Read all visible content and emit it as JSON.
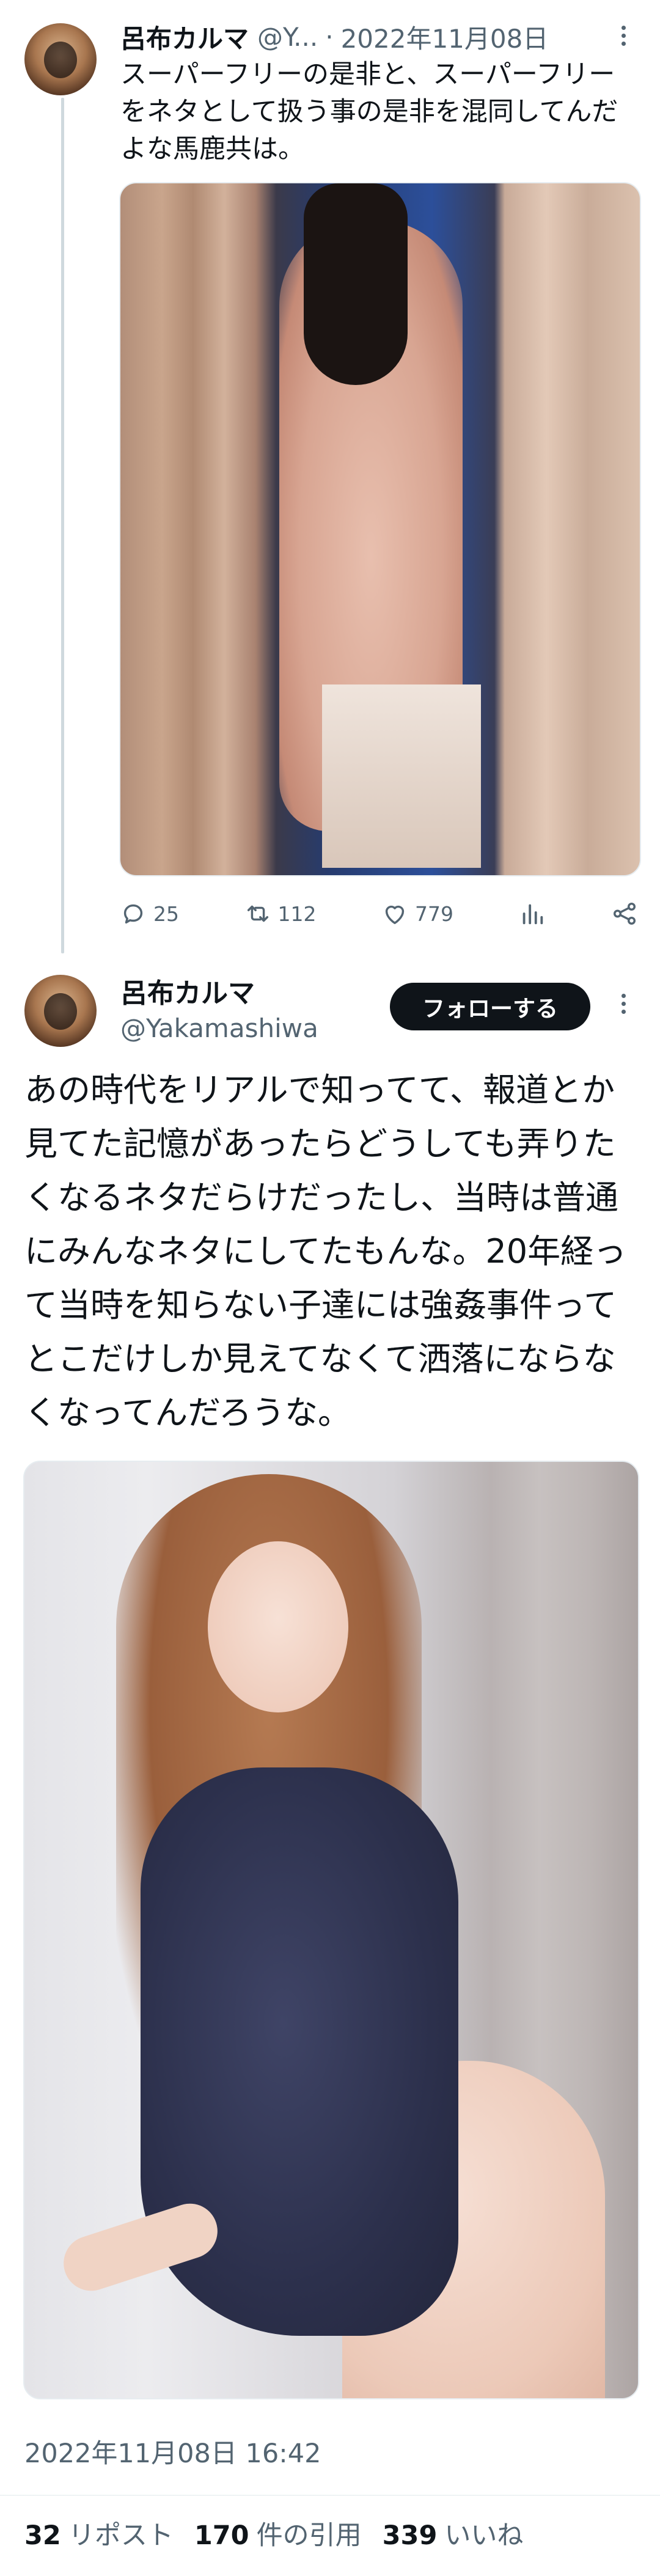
{
  "parent_tweet": {
    "display_name": "呂布カルマ",
    "handle_truncated": "@Y...",
    "separator": "·",
    "date": "2022年11月08日",
    "text": "スーパーフリーの是非と、スーパーフリーをネタとして扱う事の是非を混同してんだよな馬鹿共は。",
    "actions": {
      "reply_count": "25",
      "repost_count": "112",
      "like_count": "779",
      "icons": [
        "reply-icon",
        "repost-icon",
        "like-icon",
        "views-icon",
        "share-icon"
      ]
    }
  },
  "main_tweet": {
    "display_name": "呂布カルマ",
    "handle": "@Yakamashiwa",
    "follow_label": "フォローする",
    "text": "あの時代をリアルで知ってて、報道とか見てた記憶があったらどうしても弄りたくなるネタだらけだったし、当時は普通にみんなネタにしてたもんな。20年経って当時を知らない子達には強姦事件ってとこだけしか見えてなくて洒落にならなくなってんだろうな。",
    "timestamp": "2022年11月08日 16:42",
    "stats": {
      "reposts_count": "32",
      "reposts_label": "リポスト",
      "quotes_count": "170",
      "quotes_label": "件の引用",
      "likes_count": "339",
      "likes_label": "いいね"
    }
  },
  "colors": {
    "text": "#0f1419",
    "muted": "#536471",
    "thread_line": "#cfd9de",
    "follow_button": "#0f1419"
  }
}
